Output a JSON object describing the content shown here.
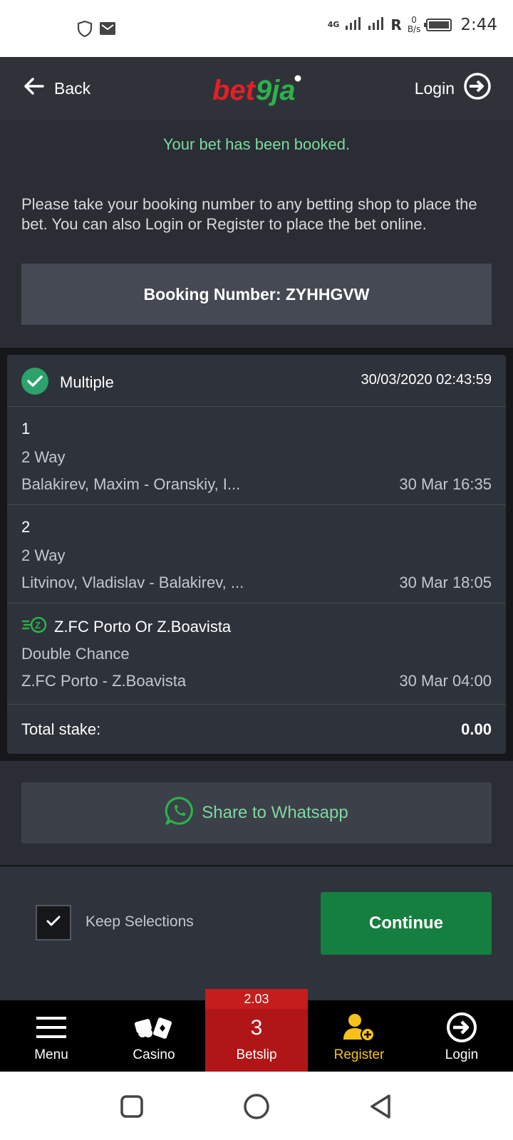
{
  "status_bar": {
    "network": "4G",
    "roaming": "R",
    "speed_value": "0",
    "speed_unit": "B/s",
    "time": "2:44"
  },
  "header": {
    "back_label": "Back",
    "logo_text": "bet9ja",
    "login_label": "Login"
  },
  "booking": {
    "confirmation": "Your bet has been booked.",
    "info": "Please take your booking number to any betting shop to place the bet. You can also Login or Register to place the bet online.",
    "booking_number_label": "Booking Number: ZYHHGVW"
  },
  "bet": {
    "type": "Multiple",
    "datetime": "30/03/2020 02:43:59",
    "selections": [
      {
        "number": "1",
        "market": "2 Way",
        "match": "Balakirev, Maxim - Oranskiy, I...",
        "time": "30 Mar 16:35"
      },
      {
        "number": "2",
        "market": "2 Way",
        "match": "Litvinov, Vladislav - Balakirev, ...",
        "time": "30 Mar 18:05"
      },
      {
        "pick": "Z.FC Porto Or Z.Boavista",
        "market": "Double Chance",
        "match": "Z.FC Porto - Z.Boavista",
        "time": "30 Mar 04:00"
      }
    ],
    "total_stake_label": "Total stake:",
    "total_stake_value": "0.00"
  },
  "share": {
    "label": "Share to Whatsapp"
  },
  "actions": {
    "keep_selections_label": "Keep Selections",
    "continue_label": "Continue"
  },
  "bottom_nav": {
    "menu": "Menu",
    "casino": "Casino",
    "betslip_odds": "2.03",
    "betslip_count": "3",
    "betslip_label": "Betslip",
    "register": "Register",
    "login": "Login"
  },
  "colors": {
    "accent_green": "#7ed8a0",
    "continue_green": "#157f3f",
    "betslip_red": "#b01617",
    "register_yellow": "#f5c21b"
  }
}
